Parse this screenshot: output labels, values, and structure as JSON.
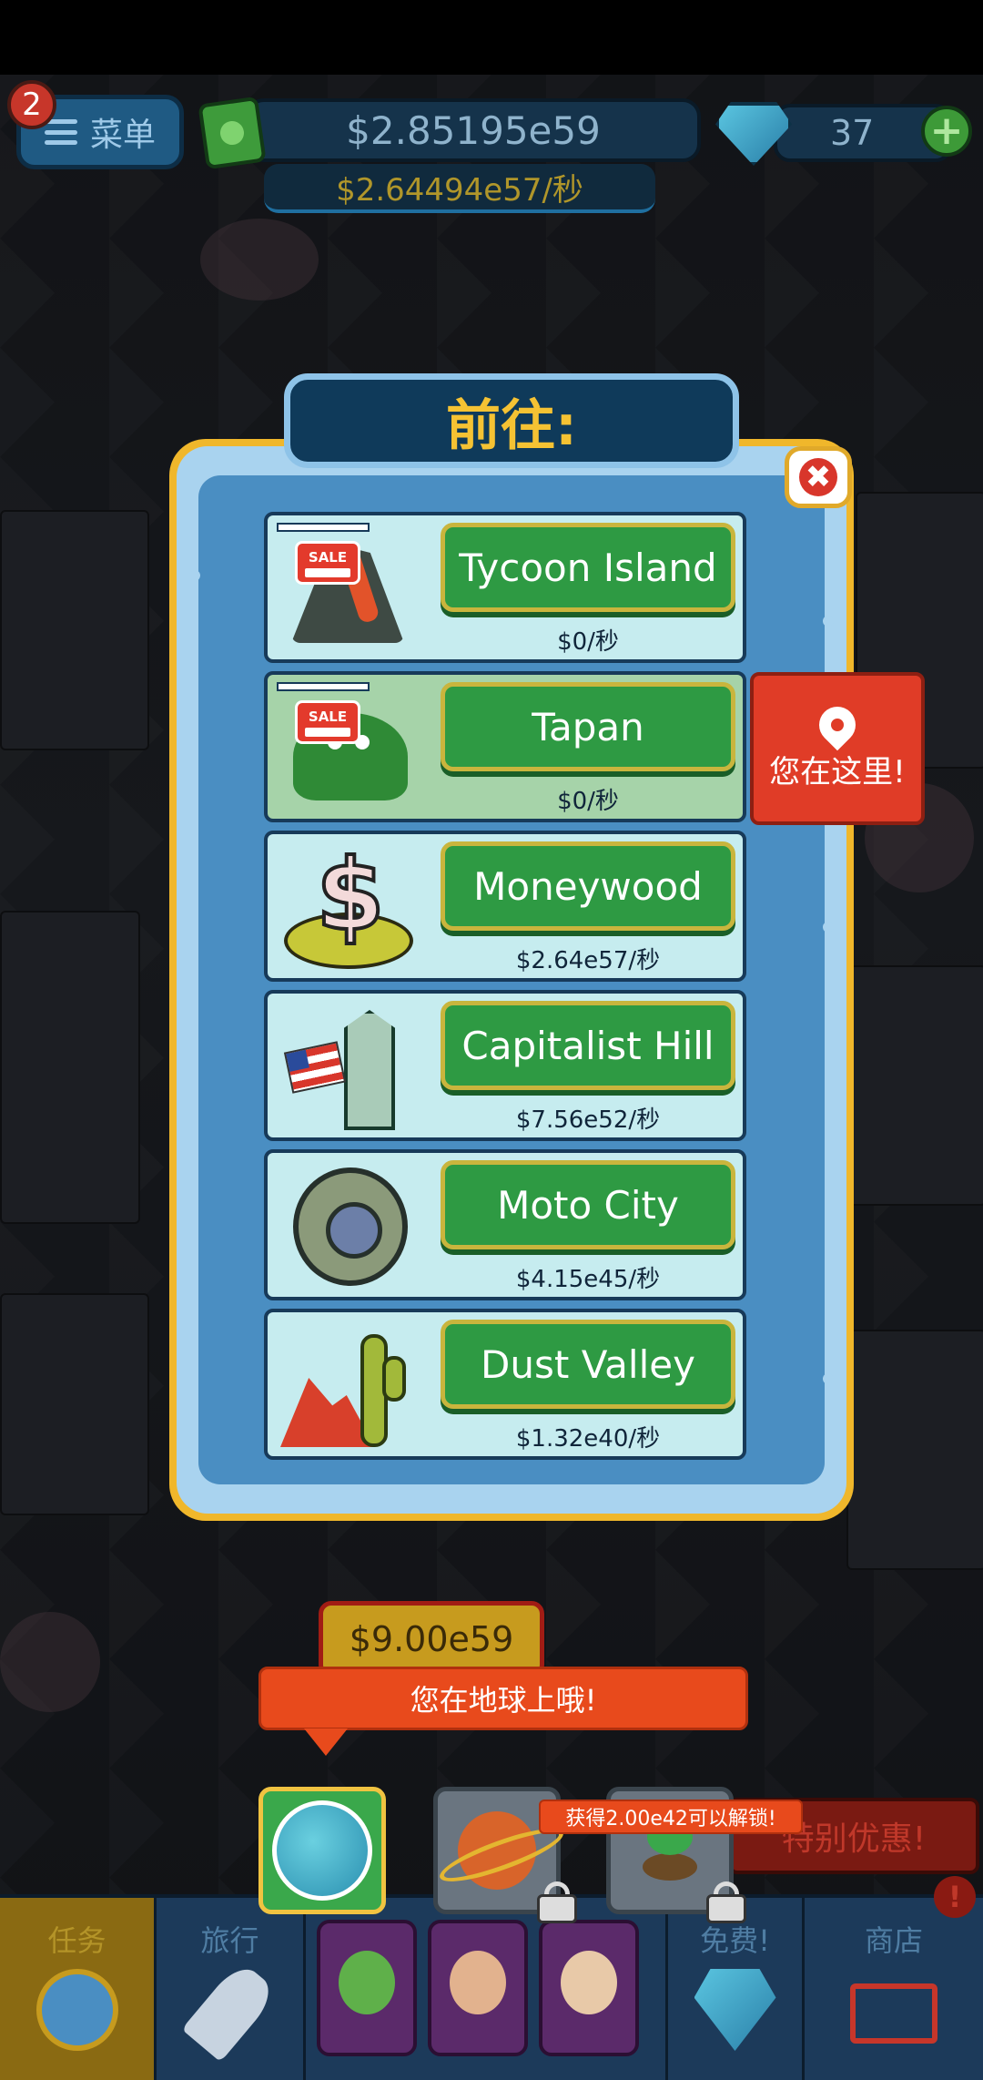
{
  "top_bar": {
    "notification_count": "2",
    "menu_label": "菜单",
    "money": "$2.85195e59",
    "money_rate": "$2.64494e57/秒",
    "gems": "37",
    "add_label": "+"
  },
  "travel_dialog": {
    "title": "前往:",
    "close_label": "✖",
    "sale_label": "SALE",
    "destinations": [
      {
        "name": "Tycoon Island",
        "rate": "$0/秒",
        "sale": true,
        "current": false,
        "icon": "volcano-icon"
      },
      {
        "name": "Tapan",
        "rate": "$0/秒",
        "sale": true,
        "current": true,
        "icon": "lizard-icon"
      },
      {
        "name": "Moneywood",
        "rate": "$2.64e57/秒",
        "sale": false,
        "current": false,
        "icon": "dollar-icon"
      },
      {
        "name": "Capitalist Hill",
        "rate": "$7.56e52/秒",
        "sale": false,
        "current": false,
        "icon": "monument-icon"
      },
      {
        "name": "Moto City",
        "rate": "$4.15e45/秒",
        "sale": false,
        "current": false,
        "icon": "tire-icon"
      },
      {
        "name": "Dust Valley",
        "rate": "$1.32e40/秒",
        "sale": false,
        "current": false,
        "icon": "cactus-icon"
      }
    ],
    "you_are_here": "您在这里!"
  },
  "planet_bar": {
    "price_tag": "$9.00e59",
    "tooltip": "您在地球上哦!",
    "unlock_tooltip": "获得2.00e42可以解锁!",
    "special_offer": "特别优惠!",
    "alert": "!"
  },
  "bottom_nav": {
    "tabs": [
      {
        "label": "任务"
      },
      {
        "label": "旅行"
      },
      {
        "label": "免费!"
      },
      {
        "label": "商店"
      }
    ]
  },
  "colors": {
    "accent_gold": "#f0b72b",
    "button_green": "#2e9a43",
    "alert_red": "#e03c27",
    "panel_blue": "#4a8ec2"
  }
}
